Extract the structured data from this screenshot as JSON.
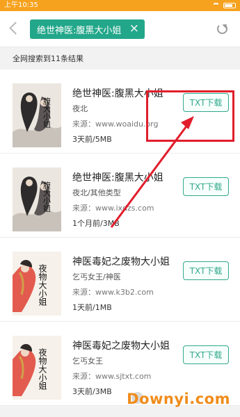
{
  "status": {
    "time": "上午10:35"
  },
  "header": {
    "search_tag": "绝世神医:腹黑大小姐",
    "close_symbol": "×"
  },
  "result_count": "全网搜索到11条结果",
  "download_label": "TXT下载",
  "books": [
    {
      "title": "绝世神医:腹黑大小姐",
      "author": "夜北",
      "source": "来源：www.woaidu.org",
      "meta": "3天前/5MB"
    },
    {
      "title": "绝世神医:腹黑大小姐",
      "author": "夜北/其他类型",
      "source": "来源：www.ixdzs.com",
      "meta": "1个月前/3MB"
    },
    {
      "title": "神医毒妃之废物大小姐",
      "author": "乞丐女王/神医",
      "source": "来源：www.k3b2.com",
      "meta": "1天前/1MB"
    },
    {
      "title": "神医毒妃之废物大小姐",
      "author": "乞丐女王",
      "source": "来源：www.sjtxt.com",
      "meta": "3天前/3MB"
    }
  ],
  "covers": [
    {
      "text": "腹大小姐",
      "palette": "ink"
    },
    {
      "text": "腹大小姐",
      "palette": "ink"
    },
    {
      "text": "夜物大小姐",
      "palette": "red"
    },
    {
      "text": "夜物大小姐",
      "palette": "red"
    }
  ],
  "watermark": "Downyi.com",
  "colors": {
    "status_bar": "#f6a21e",
    "accent": "#23a78a",
    "highlight": "#e11d2b",
    "watermark": "#f08c1b"
  }
}
